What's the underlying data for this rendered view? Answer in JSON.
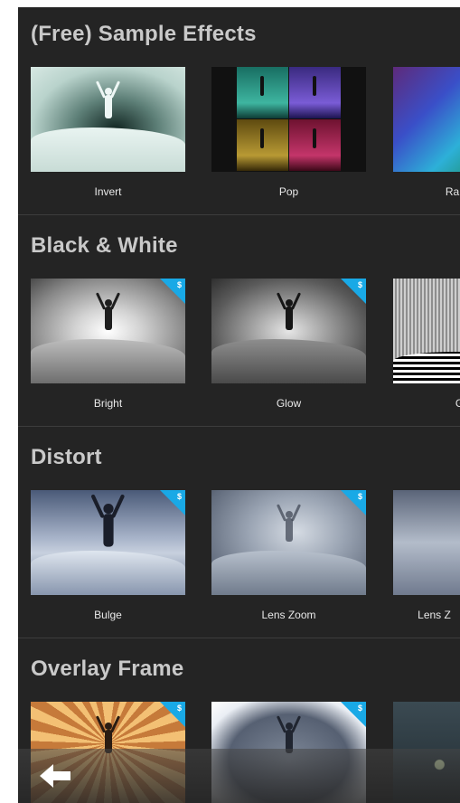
{
  "sections": [
    {
      "title": "(Free) Sample Effects",
      "effects": [
        {
          "label": "Invert",
          "premium": false
        },
        {
          "label": "Pop",
          "premium": false
        },
        {
          "label": "Ra",
          "premium": false
        }
      ]
    },
    {
      "title": "Black & White",
      "effects": [
        {
          "label": "Bright",
          "premium": true
        },
        {
          "label": "Glow",
          "premium": true
        },
        {
          "label": "G",
          "premium": false
        }
      ]
    },
    {
      "title": "Distort",
      "effects": [
        {
          "label": "Bulge",
          "premium": true
        },
        {
          "label": "Lens Zoom",
          "premium": true
        },
        {
          "label": "Lens Z",
          "premium": false
        }
      ]
    },
    {
      "title": "Overlay Frame",
      "effects": [
        {
          "premium": true
        },
        {
          "premium": true
        },
        {
          "premium": false
        }
      ]
    }
  ],
  "badge_glyph": "$",
  "bottom_bar": {
    "back_icon": "back-arrow-icon"
  },
  "colors": {
    "background": "#242424",
    "badge": "#19a9e6",
    "title": "#c9c9c9",
    "label": "#e8e8e8"
  }
}
